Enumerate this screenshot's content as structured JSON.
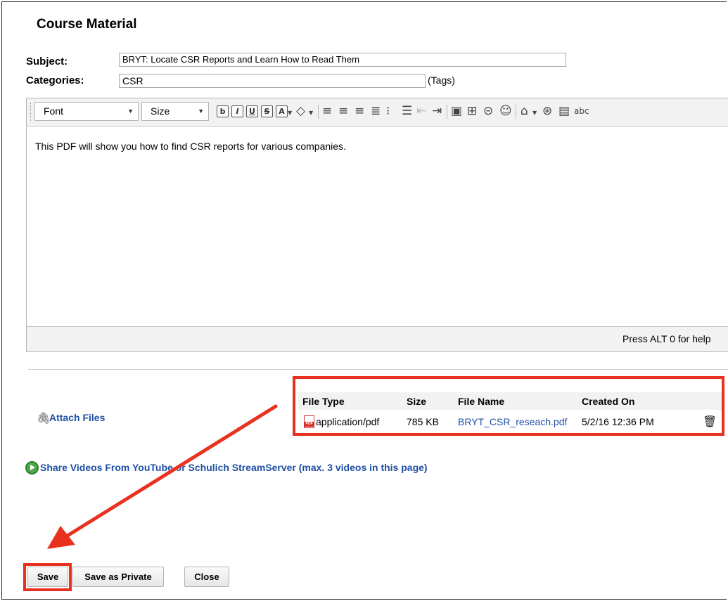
{
  "page": {
    "title": "Course Material"
  },
  "form": {
    "subject_label": "Subject:",
    "subject_value": "BRYT: Locate CSR Reports and Learn How to Read Them",
    "categories_label": "Categories:",
    "categories_value": "CSR",
    "tags_label": "(Tags)"
  },
  "editor": {
    "font_select": "Font",
    "size_select": "Size",
    "body_text": "This PDF will show you how to find CSR reports for various companies.",
    "status_help": "Press ALT 0 for help"
  },
  "attachments": {
    "attach_label": "Attach Files",
    "columns": [
      "File Type",
      "Size",
      "File Name",
      "Created On"
    ],
    "files": [
      {
        "type": "application/pdf",
        "size": "785 KB",
        "name": "BRYT_CSR_reseach.pdf",
        "created": "5/2/16 12:36 PM"
      }
    ]
  },
  "videos": {
    "link_label": "Share Videos From YouTube or Schulich StreamServer (max. 3 videos in this page)"
  },
  "actions": {
    "save_label": "Save",
    "save_private_label": "Save as Private",
    "close_label": "Close"
  },
  "colors": {
    "link": "#1f4fa5",
    "annotation": "#e8321f",
    "video_icon": "#4ea84b"
  },
  "icons": {
    "attach": "paperclip-icon",
    "file": "pdf-file-icon",
    "delete": "trash-icon",
    "video": "play-circle-icon"
  }
}
